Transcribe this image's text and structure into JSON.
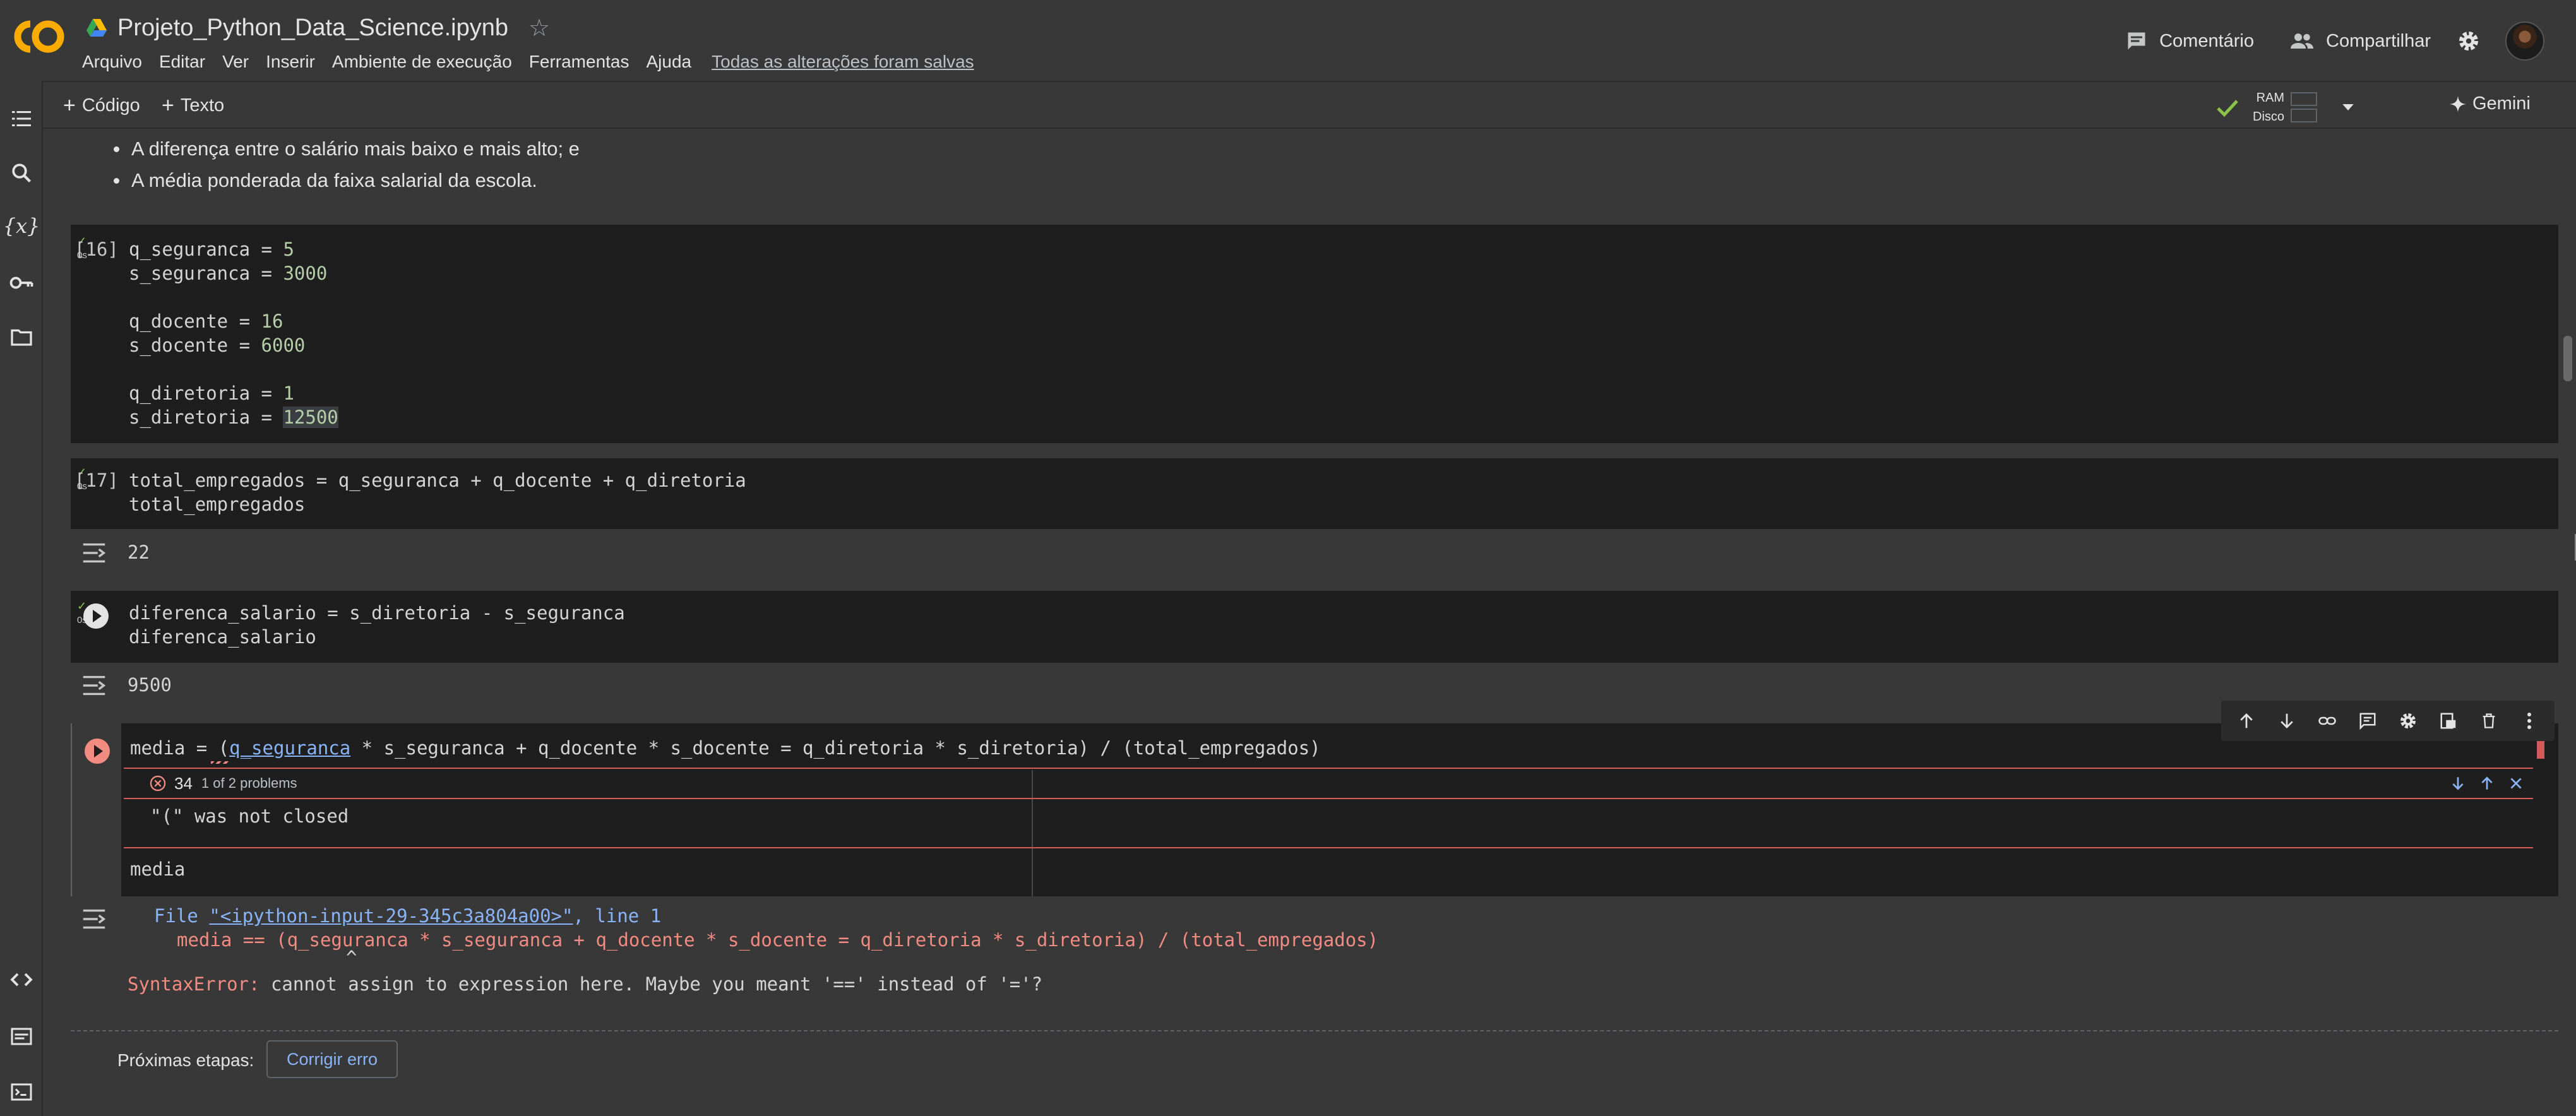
{
  "header": {
    "notebook_title": "Projeto_Python_Data_Science.ipynb",
    "menu": [
      "Arquivo",
      "Editar",
      "Ver",
      "Inserir",
      "Ambiente de execução",
      "Ferramentas",
      "Ajuda"
    ],
    "saved_status": "Todas as alterações foram salvas",
    "comment_label": "Comentário",
    "share_label": "Compartilhar"
  },
  "toolbar": {
    "code_label": "Código",
    "text_label": "Texto",
    "ram_label": "RAM",
    "disk_label": "Disco",
    "gemini_label": "Gemini"
  },
  "markdown": {
    "bullets": [
      "A diferença entre o salário mais baixo e mais alto; e",
      "A média ponderada da faixa salarial da escola."
    ]
  },
  "cells": [
    {
      "exec_count": "[16]",
      "time": "0s",
      "lines": [
        {
          "name": "q_seguranca",
          "value": "5"
        },
        {
          "name": "s_seguranca",
          "value": "3000"
        },
        {
          "name": "q_docente",
          "value": "16"
        },
        {
          "name": "s_docente",
          "value": "6000"
        },
        {
          "name": "q_diretoria",
          "value": "1"
        },
        {
          "name": "s_diretoria",
          "value": "12500"
        }
      ]
    },
    {
      "exec_count": "[17]",
      "time": "0s",
      "line1": "total_empregados = q_seguranca + q_docente + q_diretoria",
      "line2": "total_empregados",
      "output": "22"
    },
    {
      "time": "0s",
      "line1": "diferenca_salario = s_diretoria - s_seguranca",
      "line2": "diferenca_salario",
      "output": "9500"
    },
    {
      "line1_prefix": "media = (",
      "line1_link": "q_seguranca",
      "line1_rest": " * s_seguranca + q_docente * s_docente = q_diretoria * s_diretoria) / (total_empregados)",
      "error_count": "34",
      "error_summary": "1 of 2 problems",
      "error_message": "\"(\" was not closed",
      "line2": "media"
    }
  ],
  "traceback": {
    "file_prefix": "File ",
    "file_link": "\"<ipython-input-29-345c3a804a00>\"",
    "file_suffix": ", line 1",
    "code": "media == (q_seguranca * s_seguranca + q_docente * s_docente = q_diretoria * s_diretoria) / (total_empregados)",
    "caret": "^",
    "error_type": "SyntaxError:",
    "error_text": " cannot assign to expression here. Maybe you meant '==' instead of '='?"
  },
  "next_steps": {
    "label": "Próximas etapas:",
    "fix_button": "Corrigir erro"
  },
  "colors": {
    "background": "#383838",
    "cell_background": "#1e1e1e",
    "number": "#b5cea8",
    "error": "#f28b82",
    "link": "#8ab4f8",
    "success": "#8bc34a"
  }
}
